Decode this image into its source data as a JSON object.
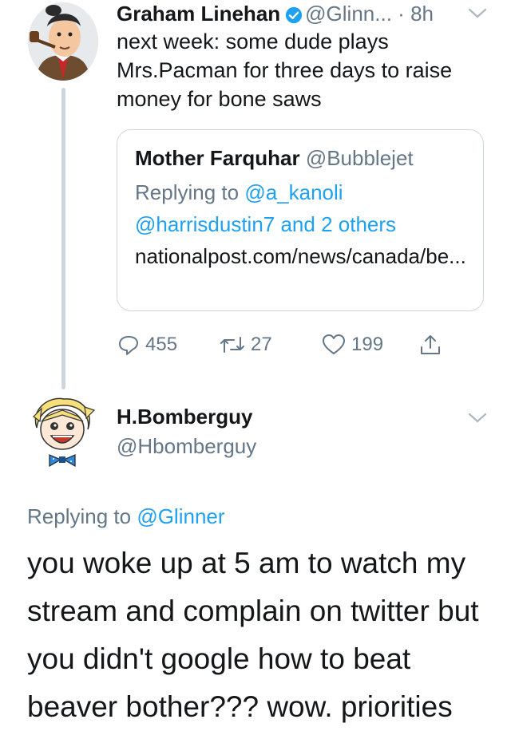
{
  "tweet1": {
    "author_name": "Graham Linehan",
    "author_handle": "@Glinn...",
    "separator": "·",
    "time": "8h",
    "verified": true,
    "text": "next week: some dude plays Mrs.Pacman for three days to raise money for bone saws",
    "quote": {
      "author_name": "Mother Farquhar",
      "author_handle": "@Bubblejet",
      "replying_prefix": "Replying to ",
      "replying_to": "@a_kanoli @harrisdustin7 and 2 others",
      "link_text": "nationalpost.com/news/canada/be..."
    },
    "actions": {
      "replies": "455",
      "retweets": "27",
      "likes": "199"
    }
  },
  "tweet2": {
    "author_name": "H.Bomberguy",
    "author_handle": "@Hbomberguy",
    "replying_prefix": "Replying to ",
    "replying_to": "@Glinner",
    "text": "you woke up at 5 am to watch my stream and complain on twitter but you didn't google how to beat beaver bother??? wow. priorities"
  },
  "colors": {
    "text": "#14171a",
    "secondary": "#657786",
    "link": "#1da1f2",
    "border": "#ccd6dd",
    "thread_line": "#ccd6dd"
  },
  "icons": [
    "verified-badge-icon",
    "chevron-down-icon",
    "reply-icon",
    "retweet-icon",
    "like-icon",
    "share-icon"
  ]
}
